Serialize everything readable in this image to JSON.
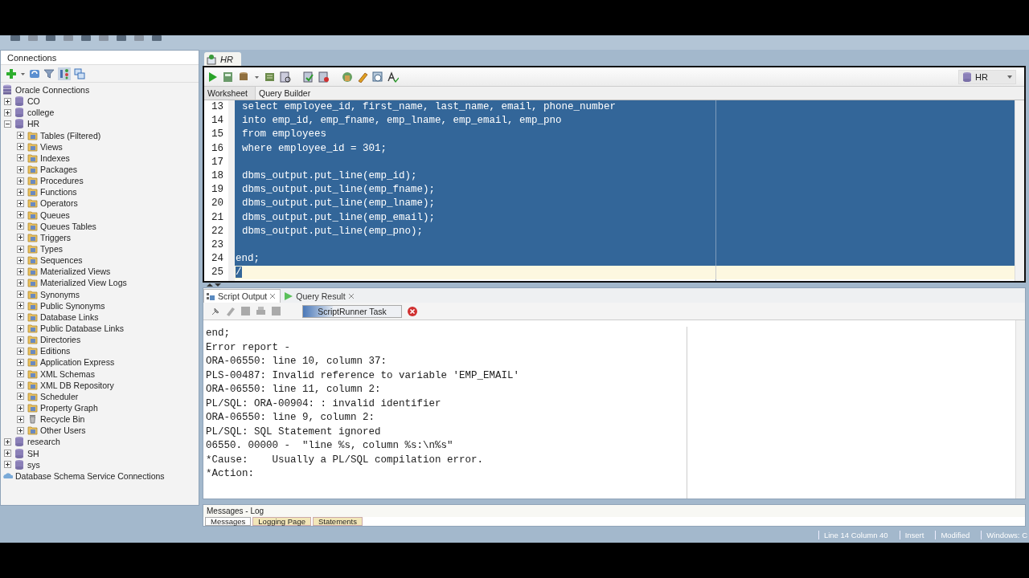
{
  "connections_panel": {
    "title": "Connections",
    "tree": [
      {
        "label": "Oracle Connections",
        "kind": "root",
        "children": [
          {
            "label": "CO",
            "kind": "connection",
            "expanded": false
          },
          {
            "label": "college",
            "kind": "connection",
            "expanded": false
          },
          {
            "label": "HR",
            "kind": "connection",
            "expanded": true,
            "children": [
              {
                "label": "Tables (Filtered)",
                "kind": "folder",
                "expanded": false
              },
              {
                "label": "Views",
                "kind": "folder",
                "expanded": false
              },
              {
                "label": "Indexes",
                "kind": "folder",
                "expanded": false
              },
              {
                "label": "Packages",
                "kind": "folder",
                "expanded": false
              },
              {
                "label": "Procedures",
                "kind": "folder",
                "expanded": false
              },
              {
                "label": "Functions",
                "kind": "folder",
                "expanded": false
              },
              {
                "label": "Operators",
                "kind": "folder",
                "expanded": false
              },
              {
                "label": "Queues",
                "kind": "folder",
                "expanded": false
              },
              {
                "label": "Queues Tables",
                "kind": "folder",
                "expanded": false
              },
              {
                "label": "Triggers",
                "kind": "folder",
                "expanded": false
              },
              {
                "label": "Types",
                "kind": "folder",
                "expanded": false
              },
              {
                "label": "Sequences",
                "kind": "folder",
                "expanded": false
              },
              {
                "label": "Materialized Views",
                "kind": "folder",
                "expanded": false
              },
              {
                "label": "Materialized View Logs",
                "kind": "folder",
                "expanded": false
              },
              {
                "label": "Synonyms",
                "kind": "folder",
                "expanded": false
              },
              {
                "label": "Public Synonyms",
                "kind": "folder",
                "expanded": false
              },
              {
                "label": "Database Links",
                "kind": "folder",
                "expanded": false
              },
              {
                "label": "Public Database Links",
                "kind": "folder",
                "expanded": false
              },
              {
                "label": "Directories",
                "kind": "folder",
                "expanded": false
              },
              {
                "label": "Editions",
                "kind": "folder",
                "expanded": false
              },
              {
                "label": "Application Express",
                "kind": "folder",
                "expanded": false
              },
              {
                "label": "XML Schemas",
                "kind": "folder",
                "expanded": false
              },
              {
                "label": "XML DB Repository",
                "kind": "folder",
                "expanded": false
              },
              {
                "label": "Scheduler",
                "kind": "folder",
                "expanded": false
              },
              {
                "label": "Property Graph",
                "kind": "folder",
                "expanded": false
              },
              {
                "label": "Recycle Bin",
                "kind": "bin",
                "expanded": false
              },
              {
                "label": "Other Users",
                "kind": "folder",
                "expanded": false
              }
            ]
          },
          {
            "label": "research",
            "kind": "connection",
            "expanded": false
          },
          {
            "label": "SH",
            "kind": "connection",
            "expanded": false
          },
          {
            "label": "sys",
            "kind": "connection",
            "expanded": false
          }
        ]
      },
      {
        "label": "Database Schema Service Connections",
        "kind": "cloud"
      }
    ]
  },
  "document_tab": {
    "label": "HR"
  },
  "connection_selector": {
    "value": "HR"
  },
  "worksheet_tabs": [
    {
      "label": "Worksheet",
      "selected": true
    },
    {
      "label": "Query Builder",
      "selected": false
    }
  ],
  "editor_lines": [
    {
      "number": "13",
      "text": "select employee_id, first_name, last_name, email, phone_number",
      "selected": true,
      "current": false
    },
    {
      "number": "14",
      "text": "into emp_id, emp_fname, emp_lname, emp_email, emp_pno",
      "selected": true,
      "current": false
    },
    {
      "number": "15",
      "text": "from employees",
      "selected": true,
      "current": false
    },
    {
      "number": "16",
      "text": "where employee_id = 301;",
      "selected": true,
      "current": false
    },
    {
      "number": "17",
      "selected": true,
      "current": false
    },
    {
      "number": "18",
      "text": "dbms_output.put_line(emp_id);",
      "selected": true,
      "current": false
    },
    {
      "number": "19",
      "text": "dbms_output.put_line(emp_fname);",
      "selected": true,
      "current": false
    },
    {
      "number": "20",
      "text": "dbms_output.put_line(emp_lname);",
      "selected": true,
      "current": false
    },
    {
      "number": "21",
      "text": "dbms_output.put_line(emp_email);",
      "selected": true,
      "current": false
    },
    {
      "number": "22",
      "text": "dbms_output.put_line(emp_pno);",
      "selected": true,
      "current": false
    },
    {
      "number": "23",
      "selected": true,
      "current": false
    },
    {
      "number": "24",
      "text": "end;",
      "selected": true,
      "current": false,
      "outdent": true
    },
    {
      "number": "25",
      "text": "/",
      "selected": true,
      "current": true,
      "outdent": true
    }
  ],
  "output_tabs": [
    {
      "label": "Script Output",
      "selected": true
    },
    {
      "label": "Query Result",
      "selected": false
    }
  ],
  "task": {
    "label": "ScriptRunner Task",
    "level": 0.3
  },
  "output_lines": [
    "end;",
    "Error report -",
    "ORA-06550: line 10, column 37:",
    "PLS-00487: Invalid reference to variable 'EMP_EMAIL'",
    "ORA-06550: line 11, column 2:",
    "PL/SQL: ORA-00904: : invalid identifier",
    "ORA-06550: line 9, column 2:",
    "PL/SQL: SQL Statement ignored",
    "06550. 00000 -  \"line %s, column %s:\\n%s\"",
    "*Cause:    Usually a PL/SQL compilation error.",
    "*Action:"
  ],
  "log_panel": {
    "title": "Messages - Log",
    "tabs": [
      {
        "label": "Messages",
        "selected": true
      },
      {
        "label": "Logging Page",
        "selected": false
      },
      {
        "label": "Statements",
        "selected": false
      }
    ]
  },
  "status_bar": [
    "Line 14 Column 40",
    "Insert",
    "Modified",
    "Windows: C"
  ]
}
